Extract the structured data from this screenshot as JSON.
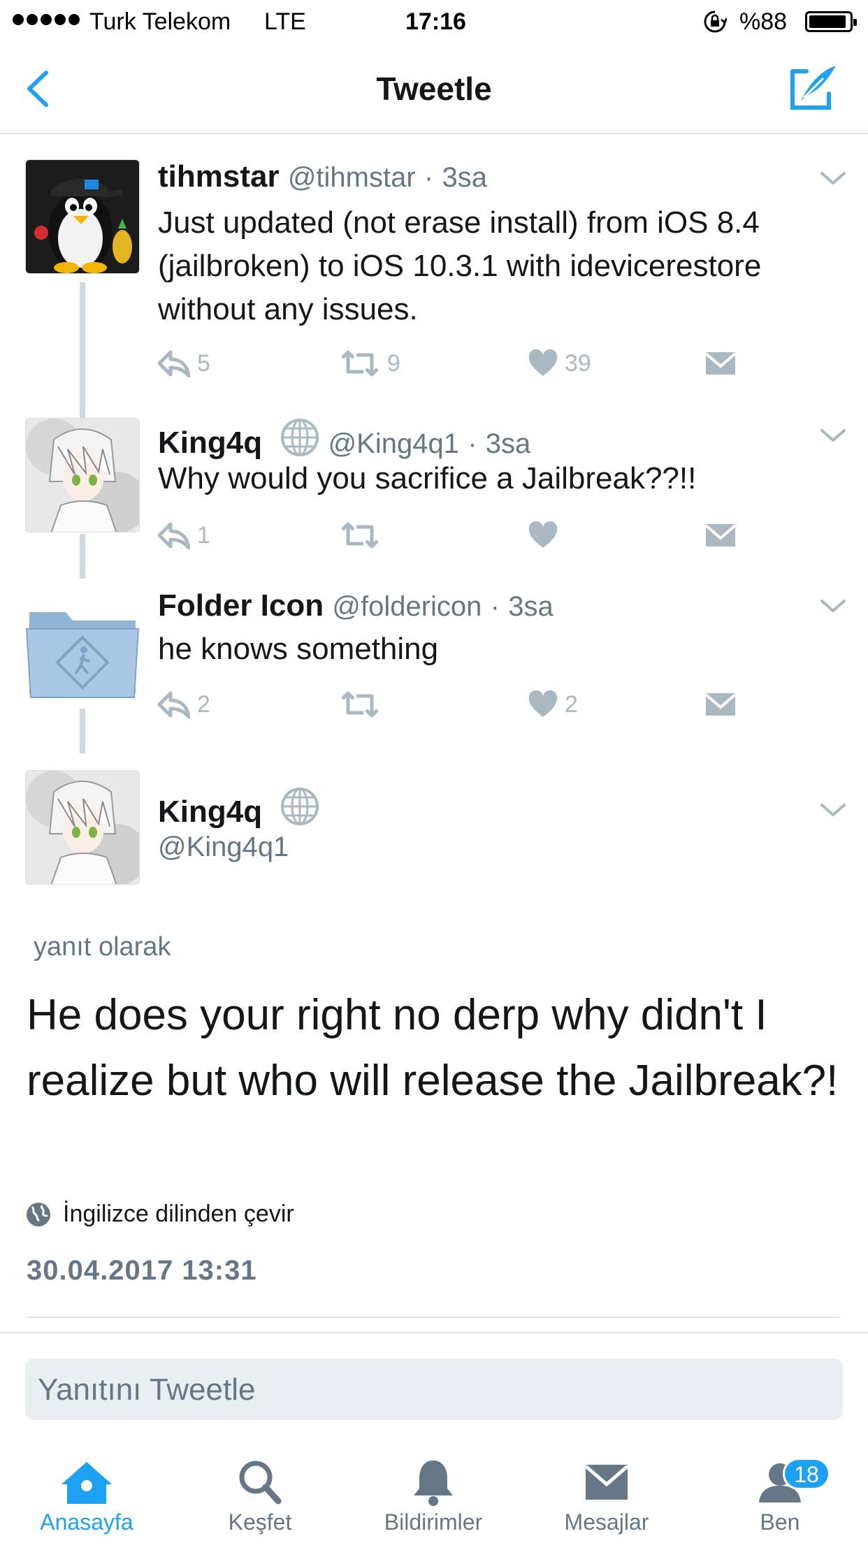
{
  "status_bar": {
    "carrier": "Turk Telekom",
    "network": "LTE",
    "time": "17:16",
    "battery": "%88"
  },
  "nav": {
    "title": "Tweetle",
    "accent": "#1da1f2"
  },
  "thread": [
    {
      "name": "tihmstar",
      "handle": "@tihmstar",
      "sep": "·",
      "time": "3sa",
      "text": "Just updated (not erase install) from iOS 8.4 (jailbroken) to iOS 10.3.1 with idevicerestore without any issues.",
      "replies": "5",
      "retweets": "9",
      "likes": "39"
    },
    {
      "name": "King4q",
      "handle": "@King4q1",
      "sep": "·",
      "time": "3sa",
      "text": "Why would you sacrifice a Jailbreak??!!",
      "replies": "1",
      "retweets": "",
      "likes": ""
    },
    {
      "name": "Folder Icon",
      "handle": "@foldericon",
      "sep": "·",
      "time": "3sa",
      "text": "he knows something",
      "replies": "2",
      "retweets": "",
      "likes": "2"
    }
  ],
  "focused": {
    "name": "King4q",
    "handle": "@King4q1",
    "in_reply_label": "yanıt olarak",
    "text": "He does your right no derp why didn't I realize but who will release the Jailbreak?!",
    "translate_label": "İngilizce dilinden çevir",
    "timestamp": "30.04.2017 13:31"
  },
  "reply_box": {
    "placeholder": "Yanıtını Tweetle"
  },
  "tabs": [
    {
      "label": "Anasayfa",
      "icon": "home-icon",
      "active": true
    },
    {
      "label": "Keşfet",
      "icon": "search-icon",
      "active": false
    },
    {
      "label": "Bildirimler",
      "icon": "bell-icon",
      "active": false
    },
    {
      "label": "Mesajlar",
      "icon": "envelope-icon",
      "active": false
    },
    {
      "label": "Ben",
      "icon": "profile-icon",
      "active": false
    }
  ],
  "profile_badge": "18"
}
